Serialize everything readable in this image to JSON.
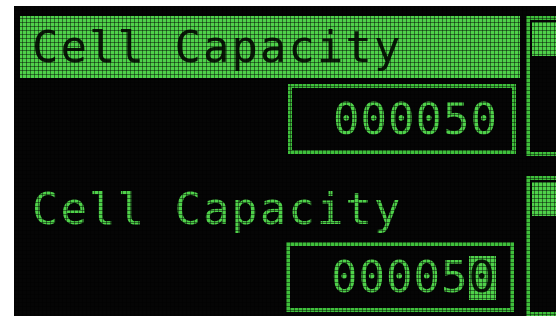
{
  "display": {
    "accent": "#4fd14a",
    "background": "#050505"
  },
  "top_panel": {
    "title": "Cell Capacity",
    "title_highlighted": true,
    "value": "000050"
  },
  "bottom_panel": {
    "title": "Cell Capacity",
    "title_highlighted": false,
    "value_prefix": "00005",
    "value_cursor_char": "0",
    "cursor_active": true
  },
  "scrollbar": {
    "icon": "scroll-track"
  }
}
